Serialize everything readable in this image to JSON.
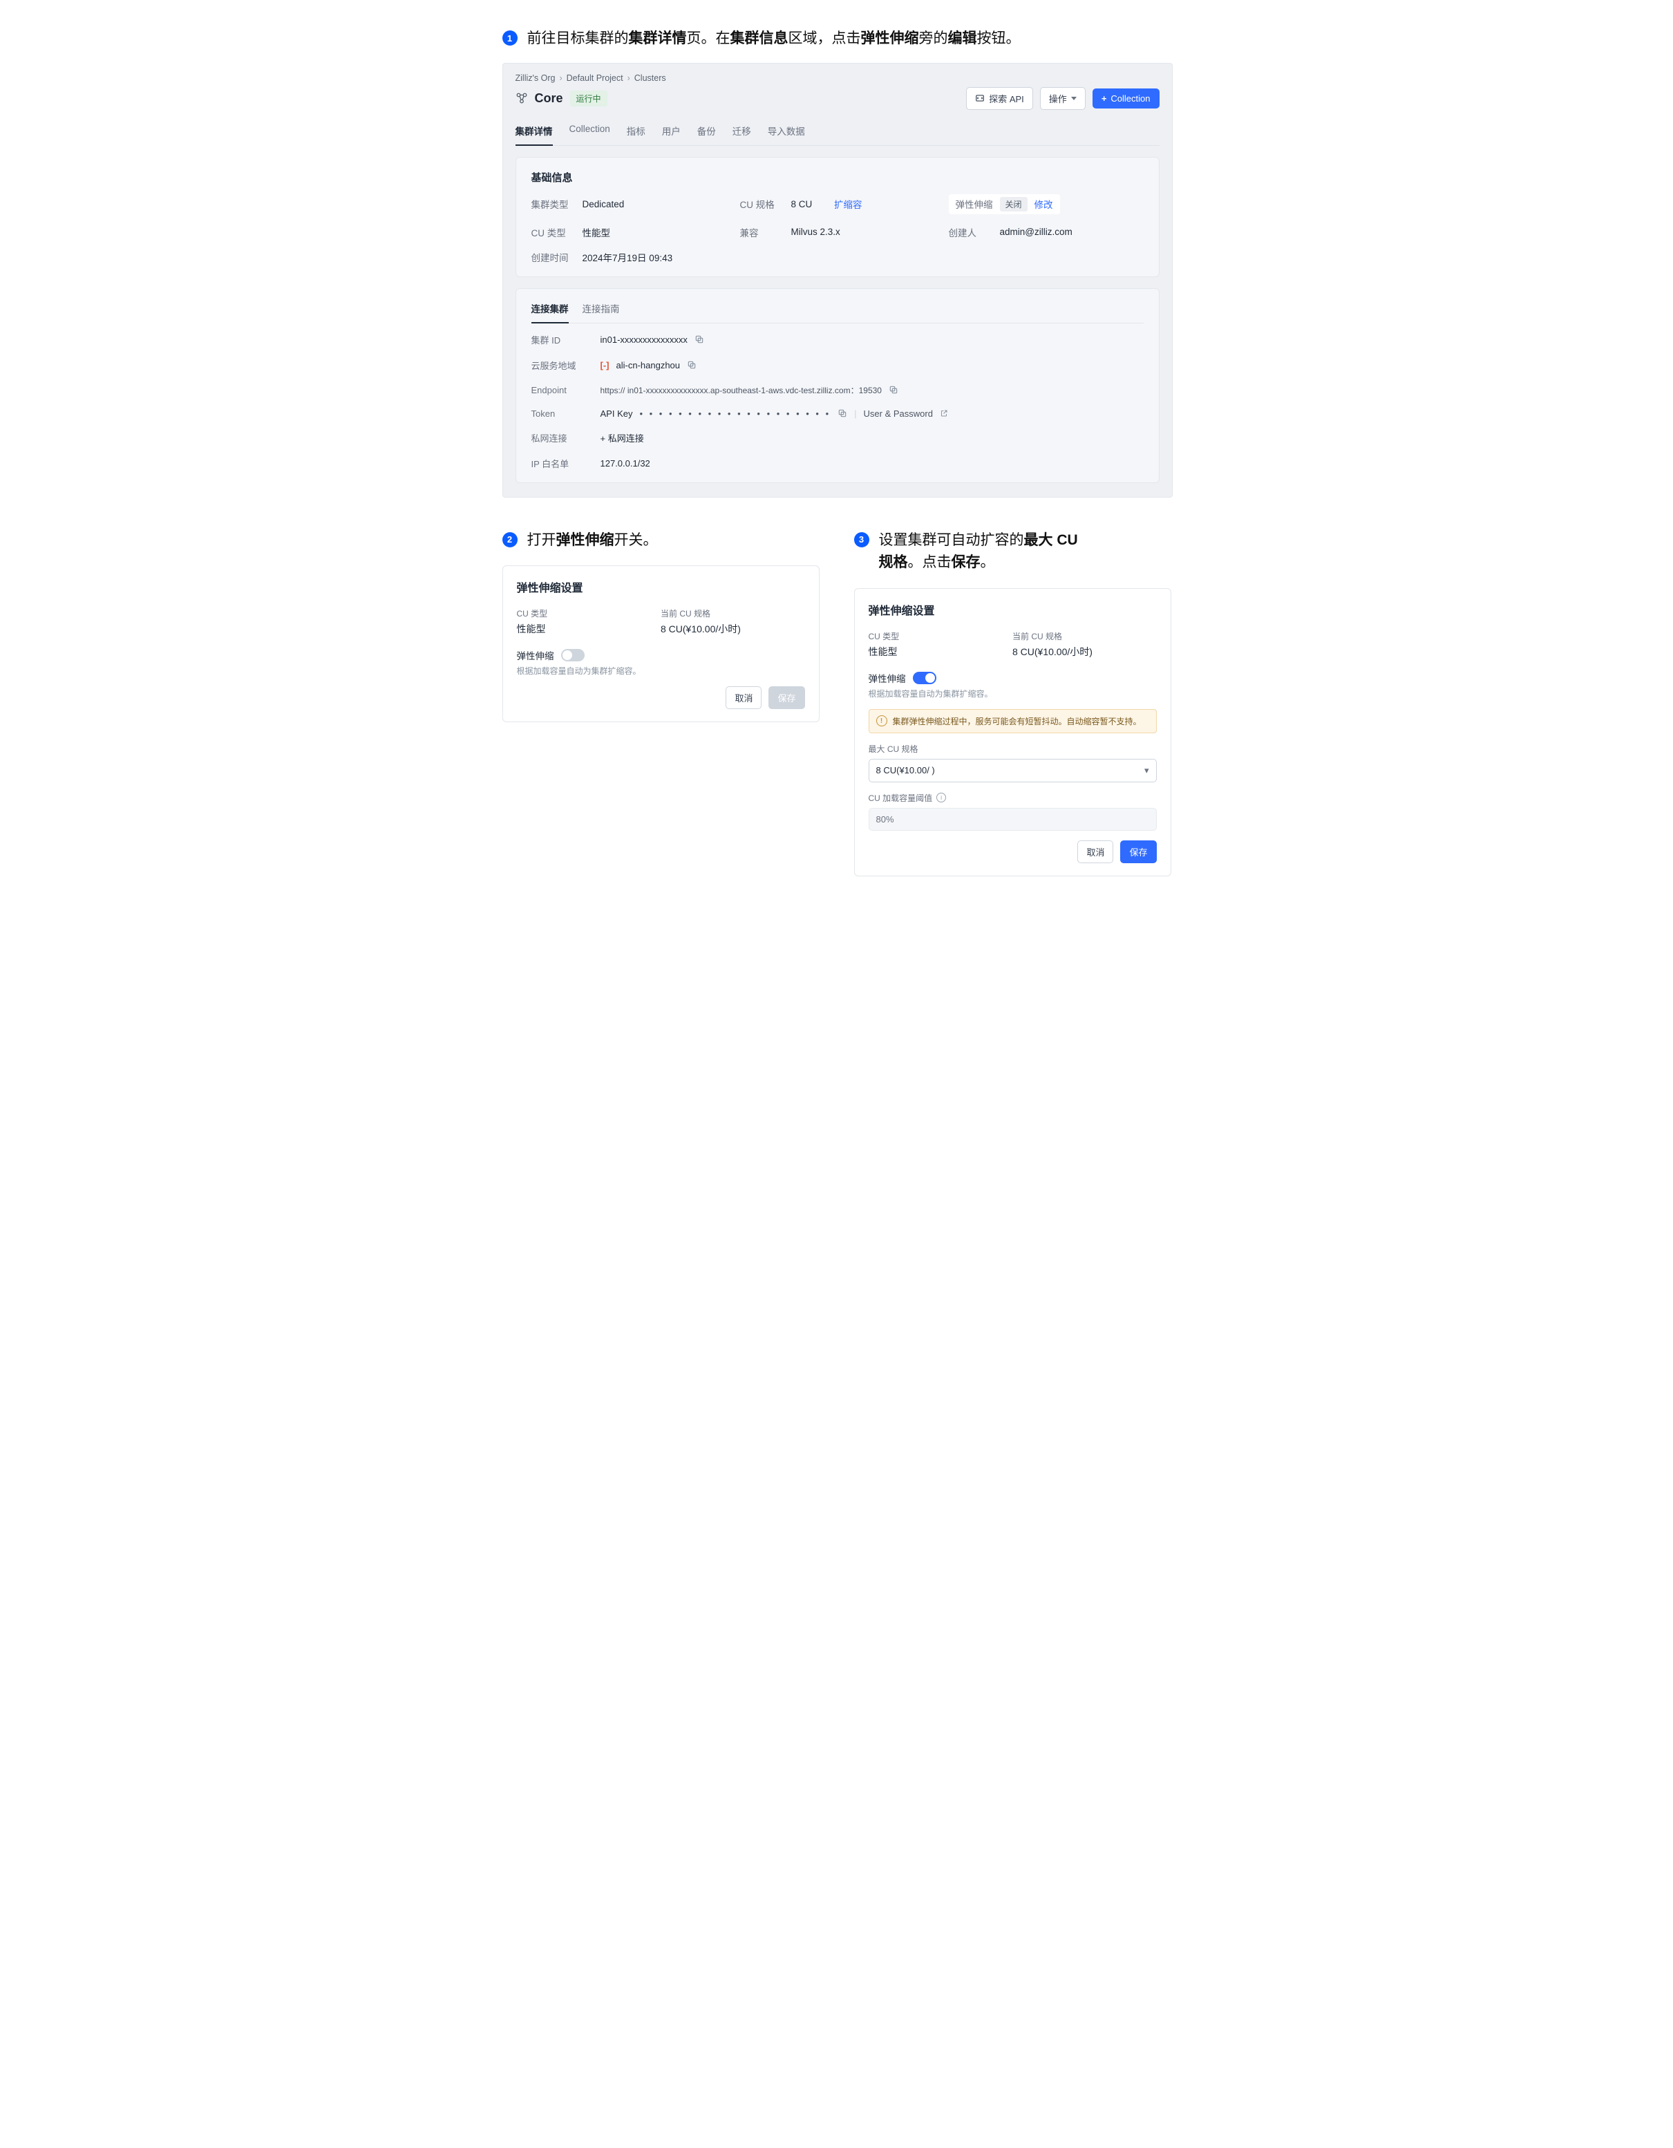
{
  "step1": {
    "num": "1",
    "text_pre": "前往目标集群的",
    "b1": "集群详情",
    "text_mid1": "页。在",
    "b2": "集群信息",
    "text_mid2": "区域，点击",
    "b3": "弹性伸缩",
    "text_mid3": "旁的",
    "b4": "编辑",
    "text_post": "按钮。"
  },
  "shot": {
    "breadcrumb": {
      "org": "Zilliz's Org",
      "project": "Default Project",
      "page": "Clusters"
    },
    "cluster_name": "Core",
    "run_badge": "运行中",
    "explore_api": "探索 API",
    "actions": "操作",
    "add_collection": "Collection",
    "tabs": {
      "details": "集群详情",
      "collection": "Collection",
      "metrics": "指标",
      "users": "用户",
      "backup": "备份",
      "migrate": "迁移",
      "import": "导入数据"
    },
    "basic_title": "基础信息",
    "basic": {
      "cluster_type": {
        "lbl": "集群类型",
        "val": "Dedicated"
      },
      "cu_spec": {
        "lbl": "CU 规格",
        "val": "8 CU",
        "link": "扩缩容"
      },
      "autoscale": {
        "lbl": "弹性伸缩",
        "pill": "关闭",
        "link": "修改"
      },
      "cu_type": {
        "lbl": "CU 类型",
        "val": "性能型"
      },
      "compat": {
        "lbl": "兼容",
        "val": "Milvus 2.3.x"
      },
      "creator": {
        "lbl": "创建人",
        "val": "admin@zilliz.com"
      },
      "created": {
        "lbl": "创建时间",
        "val": "2024年7月19日 09:43"
      }
    },
    "conn_tabs": {
      "cluster": "连接集群",
      "guide": "连接指南"
    },
    "conn": {
      "id": {
        "lbl": "集群 ID",
        "val": "in01-xxxxxxxxxxxxxxx"
      },
      "region": {
        "lbl": "云服务地域",
        "val": "ali-cn-hangzhou"
      },
      "endpoint": {
        "lbl": "Endpoint",
        "val": "https:// in01-xxxxxxxxxxxxxxx.ap-southeast-1-aws.vdc-test.zilliz.com：19530"
      },
      "token": {
        "lbl": "Token",
        "prefix": "API Key",
        "userpass": "User & Password"
      },
      "private": {
        "lbl": "私网连接",
        "val": "+ 私网连接"
      },
      "ipwl": {
        "lbl": "IP 白名单",
        "val": "127.0.0.1/32"
      }
    }
  },
  "step2": {
    "num": "2",
    "t1": "打开",
    "b1": "弹性伸缩",
    "t2": "开关。"
  },
  "step3": {
    "num": "3",
    "t1": "设置集群可自动扩容的",
    "b1": "最大 CU",
    "br": " ",
    "b2": "规格",
    "t2": "。点击",
    "b3": "保存",
    "t3": "。"
  },
  "dlg2": {
    "title": "弹性伸缩设置",
    "cu_type_lbl": "CU 类型",
    "cu_type_val": "性能型",
    "cur_lbl": "当前 CU 规格",
    "cur_val": "8 CU(¥10.00/小时)",
    "toggle_lbl": "弹性伸缩",
    "hint": "根据加载容量自动为集群扩缩容。",
    "cancel": "取消",
    "save": "保存"
  },
  "dlg3": {
    "title": "弹性伸缩设置",
    "cu_type_lbl": "CU 类型",
    "cu_type_val": "性能型",
    "cur_lbl": "当前 CU 规格",
    "cur_val": "8 CU(¥10.00/小时)",
    "toggle_lbl": "弹性伸缩",
    "hint": "根据加载容量自动为集群扩缩容。",
    "alert": "集群弹性伸缩过程中，服务可能会有短暂抖动。自动缩容暂不支持。",
    "max_lbl": "最大 CU 规格",
    "max_val": "8 CU(¥10.00/    )",
    "thresh_lbl": "CU 加载容量阈值",
    "thresh_val": "80%",
    "cancel": "取消",
    "save": "保存"
  }
}
